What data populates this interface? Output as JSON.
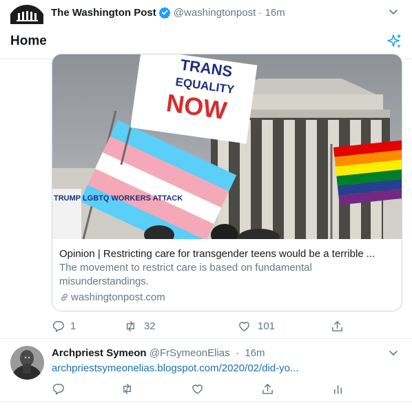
{
  "tweet1": {
    "display_name": "The Washington Post",
    "handle": "@washingtonpost",
    "time": "16m",
    "card": {
      "title": "Opinion | Restricting care for transgender teens would be a terrible ...",
      "description": "The movement to restrict care is based on fundamental misunderstandings.",
      "domain": "washingtonpost.com",
      "image_flag_text_line1": "TRANS",
      "image_flag_text_line2": "EQUALITY",
      "image_flag_text_line3": "NOW",
      "image_sign_text": "TRUMP LGBTQ WORKERS ATTACK"
    },
    "actions": {
      "reply_count": "1",
      "retweet_count": "32",
      "like_count": "101"
    }
  },
  "home_header": {
    "title": "Home"
  },
  "tweet2": {
    "display_name": "Archpriest Symeon",
    "handle": "@FrSymeonElias",
    "time": "16m",
    "link_text": "archpriestsymeonelias.blogspot.com/2020/02/did-yo..."
  },
  "colors": {
    "link": "#1b6fb5",
    "secondary_text": "#657786",
    "verified_badge": "#1da1f2",
    "border": "#e6ecf0"
  },
  "icons": [
    "verified-badge-icon",
    "chevron-down-icon",
    "sparkle-icon",
    "link-icon",
    "reply-icon",
    "retweet-icon",
    "like-icon",
    "share-icon",
    "analytics-icon"
  ]
}
